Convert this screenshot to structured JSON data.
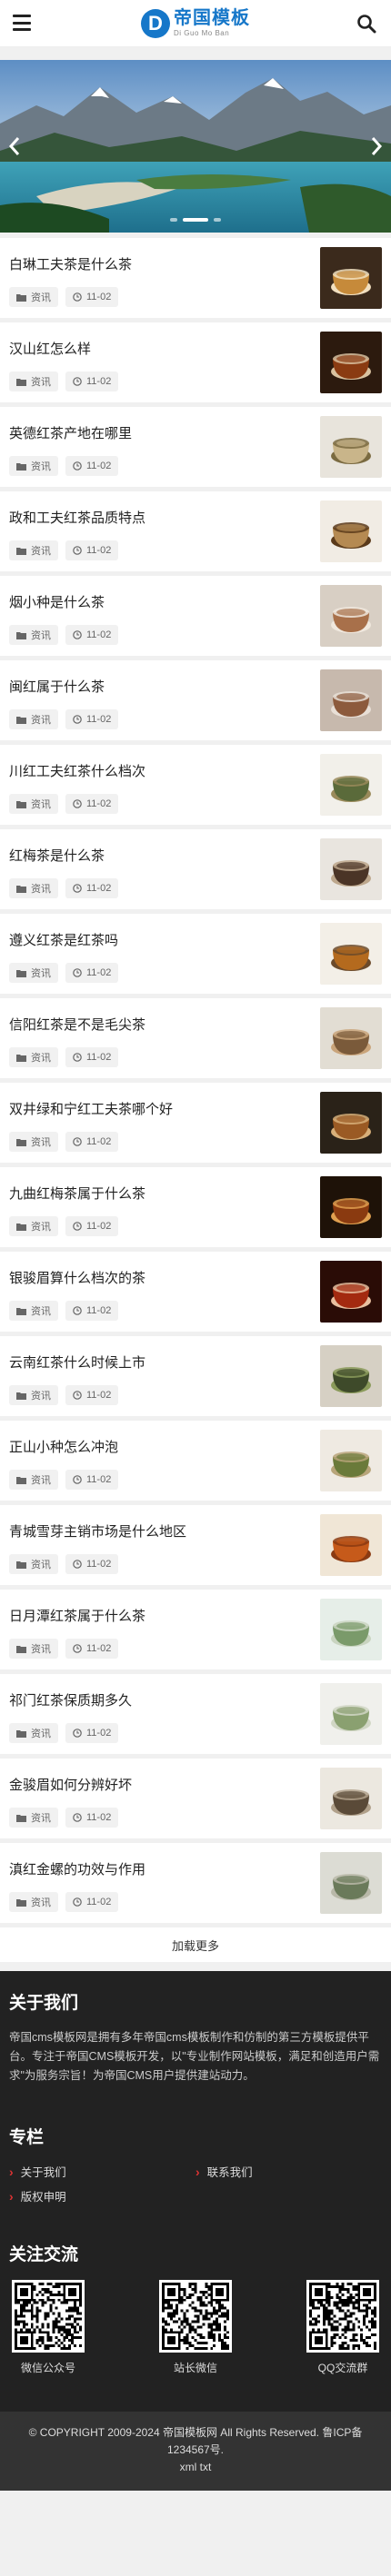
{
  "header": {
    "logo_mark": "D",
    "logo_cn": "帝国模板",
    "logo_en": "Di Guo Mo Ban"
  },
  "banner": {
    "slide_count": 3,
    "active_slide": 1
  },
  "articles": [
    {
      "title": "白琳工夫茶是什么茶",
      "category": "资讯",
      "date": "11-02"
    },
    {
      "title": "汉山红怎么样",
      "category": "资讯",
      "date": "11-02"
    },
    {
      "title": "英德红茶产地在哪里",
      "category": "资讯",
      "date": "11-02"
    },
    {
      "title": "政和工夫红茶品质特点",
      "category": "资讯",
      "date": "11-02"
    },
    {
      "title": "烟小种是什么茶",
      "category": "资讯",
      "date": "11-02"
    },
    {
      "title": "闽红属于什么茶",
      "category": "资讯",
      "date": "11-02"
    },
    {
      "title": "川红工夫红茶什么档次",
      "category": "资讯",
      "date": "11-02"
    },
    {
      "title": "红梅茶是什么茶",
      "category": "资讯",
      "date": "11-02"
    },
    {
      "title": "遵义红茶是红茶吗",
      "category": "资讯",
      "date": "11-02"
    },
    {
      "title": "信阳红茶是不是毛尖茶",
      "category": "资讯",
      "date": "11-02"
    },
    {
      "title": "双井绿和宁红工夫茶哪个好",
      "category": "资讯",
      "date": "11-02"
    },
    {
      "title": "九曲红梅茶属于什么茶",
      "category": "资讯",
      "date": "11-02"
    },
    {
      "title": "银骏眉算什么档次的茶",
      "category": "资讯",
      "date": "11-02"
    },
    {
      "title": "云南红茶什么时候上市",
      "category": "资讯",
      "date": "11-02"
    },
    {
      "title": "正山小种怎么冲泡",
      "category": "资讯",
      "date": "11-02"
    },
    {
      "title": "青城雪芽主销市场是什么地区",
      "category": "资讯",
      "date": "11-02"
    },
    {
      "title": "日月潭红茶属于什么茶",
      "category": "资讯",
      "date": "11-02"
    },
    {
      "title": "祁门红茶保质期多久",
      "category": "资讯",
      "date": "11-02"
    },
    {
      "title": "金骏眉如何分辨好坏",
      "category": "资讯",
      "date": "11-02"
    },
    {
      "title": "滇红金螺的功效与作用",
      "category": "资讯",
      "date": "11-02"
    }
  ],
  "load_more": "加载更多",
  "footer": {
    "about_title": "关于我们",
    "about_text": "帝国cms模板网是拥有多年帝国cms模板制作和仿制的第三方模板提供平台。专注于帝国CMS模板开发，以\"专业制作网站模板，满足和创造用户需求\"为服务宗旨！为帝国CMS用户提供建站动力。",
    "column_title": "专栏",
    "links": [
      "关于我们",
      "联系我们",
      "版权申明"
    ],
    "follow_title": "关注交流",
    "qrcodes": [
      "微信公众号",
      "站长微信",
      "QQ交流群"
    ],
    "copyright": "© COPYRIGHT 2009-2024 帝国模板网 All Rights Reserved. 鲁ICP备1234567号.",
    "sitemap": "xml txt"
  },
  "colors": {
    "brand": "#1677c9",
    "footer_bg": "#222222",
    "accent_red": "#dd3333"
  }
}
